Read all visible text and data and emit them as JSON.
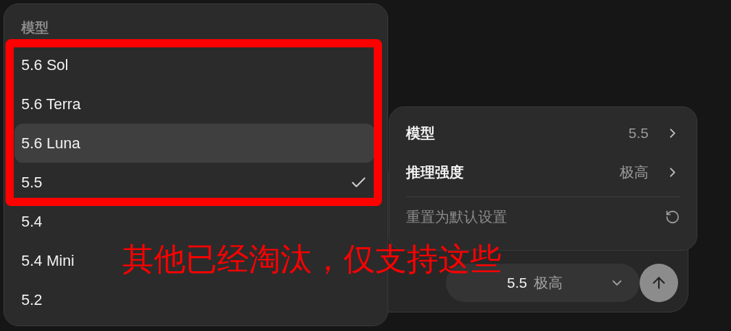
{
  "model_menu": {
    "header": "模型",
    "items": [
      {
        "label": "5.6 Sol",
        "highlighted": false,
        "checked": false
      },
      {
        "label": "5.6 Terra",
        "highlighted": false,
        "checked": false
      },
      {
        "label": "5.6 Luna",
        "highlighted": true,
        "checked": false
      },
      {
        "label": "5.5",
        "highlighted": false,
        "checked": true
      },
      {
        "label": "5.4",
        "highlighted": false,
        "checked": false
      },
      {
        "label": "5.4 Mini",
        "highlighted": false,
        "checked": false
      },
      {
        "label": "5.2",
        "highlighted": false,
        "checked": false
      }
    ]
  },
  "settings_menu": {
    "rows": [
      {
        "label": "模型",
        "value": "5.5"
      },
      {
        "label": "推理强度",
        "value": "极高"
      }
    ],
    "reset": {
      "label": "重置为默认设置"
    }
  },
  "composer": {
    "model_pill": {
      "model": "5.5",
      "effort": "极高"
    }
  },
  "annotation": {
    "text": "其他已经淘汰，仅支持这些"
  }
}
